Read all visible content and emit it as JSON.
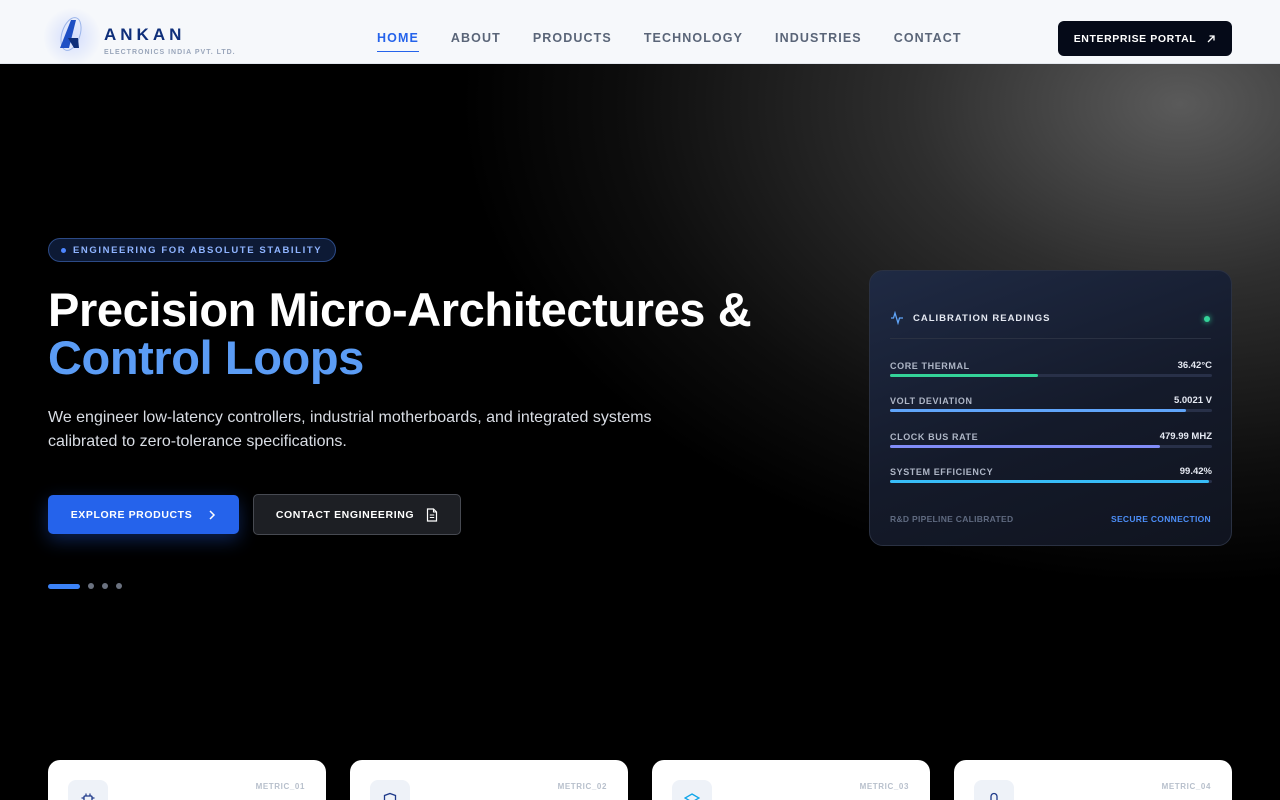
{
  "brand": {
    "name": "ANKAN",
    "subtitle": "ELECTRONICS INDIA PVT. LTD."
  },
  "nav": {
    "items": [
      {
        "label": "HOME",
        "active": true
      },
      {
        "label": "ABOUT",
        "active": false
      },
      {
        "label": "PRODUCTS",
        "active": false
      },
      {
        "label": "TECHNOLOGY",
        "active": false
      },
      {
        "label": "INDUSTRIES",
        "active": false
      },
      {
        "label": "CONTACT",
        "active": false
      }
    ],
    "portal_label": "ENTERPRISE PORTAL",
    "portal_icon": "arrow-up-right-icon"
  },
  "hero": {
    "badge": "ENGINEERING FOR ABSOLUTE STABILITY",
    "title_line1": "Precision Micro-Architectures &",
    "title_line2": "Control Loops",
    "lead": "We engineer low-latency controllers, industrial motherboards, and integrated systems calibrated to zero-tolerance specifications.",
    "primary_cta": "EXPLORE PRODUCTS",
    "primary_icon": "chevron-right-icon",
    "secondary_cta": "CONTACT ENGINEERING",
    "secondary_icon": "document-icon",
    "slides": {
      "count": 4,
      "active_index": 0
    }
  },
  "panel": {
    "title": "CALIBRATION READINGS",
    "title_icon": "activity-icon",
    "status": "online",
    "readings": [
      {
        "label": "CORE THERMAL",
        "value": "36.42°C",
        "level": 0.46,
        "color": "#34d399"
      },
      {
        "label": "VOLT DEVIATION",
        "value": "5.0021 V",
        "level": 0.92,
        "color": "#60a5fa"
      },
      {
        "label": "CLOCK BUS RATE",
        "value": "479.99 MHZ",
        "level": 0.84,
        "color": "#818cf8"
      },
      {
        "label": "SYSTEM EFFICIENCY",
        "value": "99.42%",
        "level": 0.99,
        "color": "#38bdf8"
      }
    ],
    "footer_left": "R&D PIPELINE CALIBRATED",
    "footer_right": "SECURE CONNECTION"
  },
  "metrics": [
    {
      "tag": "METRIC_01",
      "icon": "cpu-icon"
    },
    {
      "tag": "METRIC_02",
      "icon": "shield-icon"
    },
    {
      "tag": "METRIC_03",
      "icon": "layers-icon"
    },
    {
      "tag": "METRIC_04",
      "icon": "sensor-icon"
    }
  ],
  "colors": {
    "accent": "#2563eb",
    "accent_light": "#5b9cf5",
    "brand": "#0f2f7a",
    "status_ok": "#34d399"
  }
}
